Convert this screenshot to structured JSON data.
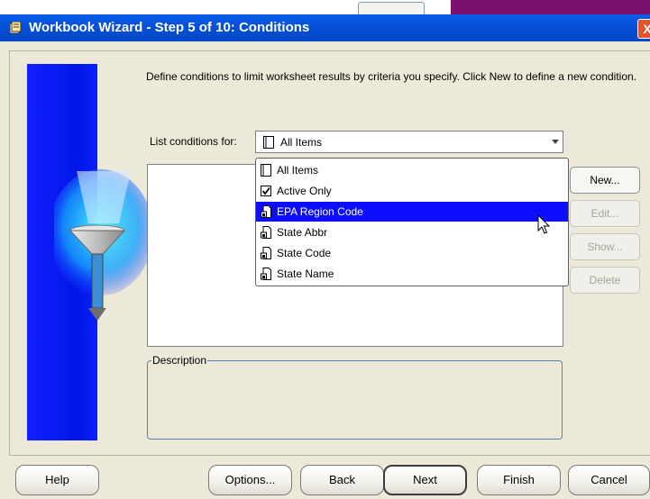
{
  "window": {
    "title": "Workbook Wizard - Step 5 of 10: Conditions",
    "close_glyph": "X"
  },
  "instructions": "Define conditions to limit worksheet results by criteria you specify. Click New to define a new condition.",
  "list_conditions": {
    "label": "List conditions for:",
    "selected": "All Items",
    "options": [
      {
        "label": "All Items",
        "icon": "folder-icon",
        "selected": false
      },
      {
        "label": "Active Only",
        "icon": "checkbox-checked-icon",
        "selected": false
      },
      {
        "label": "EPA Region Code",
        "icon": "item-icon",
        "selected": true
      },
      {
        "label": "State Abbr",
        "icon": "item-icon",
        "selected": false
      },
      {
        "label": "State Code",
        "icon": "item-icon",
        "selected": false
      },
      {
        "label": "State Name",
        "icon": "item-icon",
        "selected": false
      }
    ]
  },
  "side_buttons": {
    "new": "New...",
    "edit": "Edit...",
    "show": "Show...",
    "delete": "Delete"
  },
  "description": {
    "legend": "Description"
  },
  "footer": {
    "help": "Help",
    "options": "Options...",
    "back": "Back",
    "next": "Next",
    "finish": "Finish",
    "cancel": "Cancel"
  },
  "colors": {
    "title_bar": "#0650d9",
    "selection": "#0c0cff",
    "side_image": "#0017e6"
  }
}
